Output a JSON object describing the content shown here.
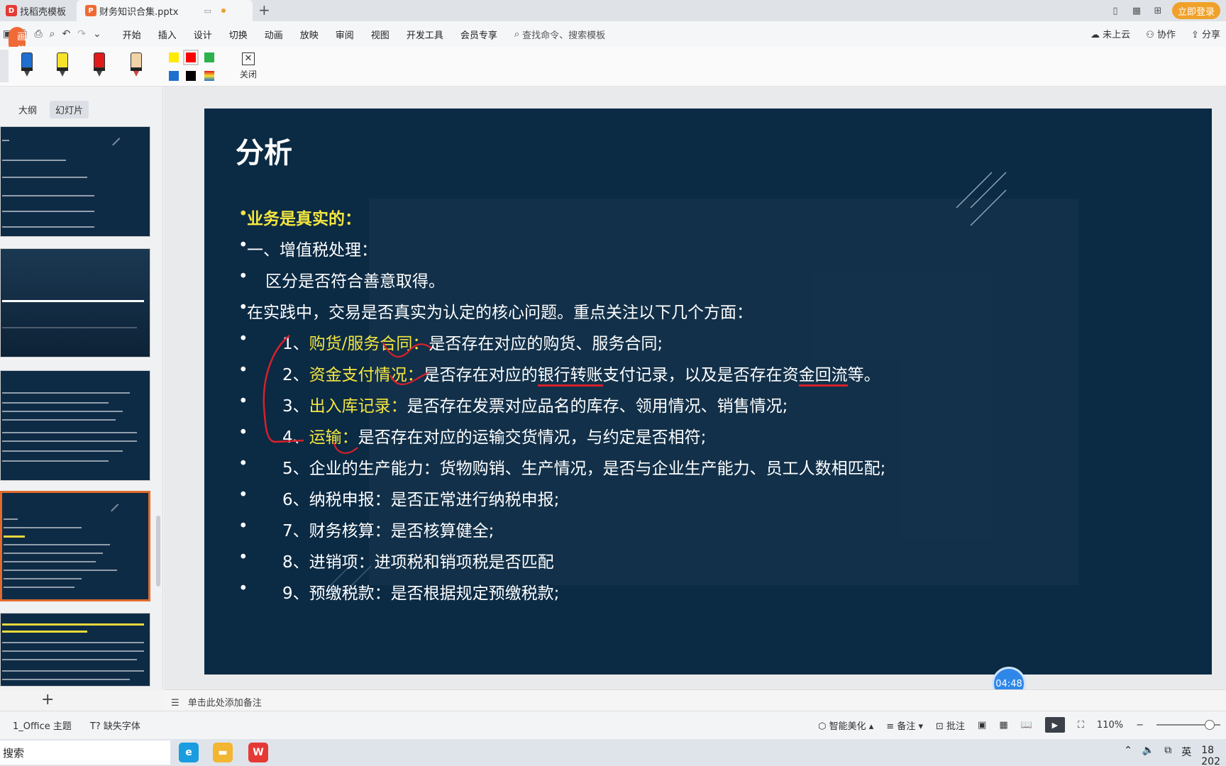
{
  "tabs": [
    {
      "label": "找稻壳模板",
      "logo": "D",
      "logo_color": "#e53935"
    },
    {
      "label": "财务知识合集.pptx",
      "logo": "P",
      "logo_color": "#f06a35"
    }
  ],
  "titlebar": {
    "login_label": "立即登录"
  },
  "menu": {
    "items": [
      "开始",
      "插入",
      "设计",
      "切换",
      "动画",
      "放映",
      "审阅",
      "视图",
      "开发工具",
      "会员专享"
    ],
    "pen_label": "画笔",
    "search_placeholder": "查找命令、搜索模板",
    "right": [
      "未上云",
      "协作",
      "分享"
    ]
  },
  "pen_toolbar": {
    "pens": [
      {
        "name": "blue-pen",
        "color": "#1f6fd1"
      },
      {
        "name": "yellow-highlighter",
        "color": "#f6e22a"
      },
      {
        "name": "red-pen",
        "color": "#e11b1b"
      },
      {
        "name": "beige-marker",
        "color": "#f1d3a8"
      }
    ],
    "swatches": [
      "#ffeb00",
      "#ff0000",
      "#2bb24c",
      "#1f6fd1",
      "#000000",
      "multi"
    ],
    "close_label": "关闭"
  },
  "left_panel": {
    "tabs": [
      "大纲",
      "幻灯片"
    ],
    "active_tab": "幻灯片"
  },
  "slide": {
    "title": "分析",
    "bullets": [
      {
        "text": "业务是真实的：",
        "style": "yellow-bold"
      },
      {
        "text": "一、增值税处理："
      },
      {
        "text": "区分是否符合善意取得。",
        "indent": 1
      },
      {
        "text": "在实践中，交易是否真实为认定的核心问题。重点关注以下几个方面："
      },
      {
        "num": "1、",
        "key": "购货/服务合同：",
        "rest": "是否存在对应的购货、服务合同;"
      },
      {
        "num": "2、",
        "key": "资金支付情况：",
        "rest_a": "是否存在对应的",
        "ul_a": "银行转账",
        "rest_b": "支付记录，以及是否存在资",
        "ul_b": "金回流",
        "rest_c": "等。"
      },
      {
        "num": "3、",
        "key": "出入库记录：",
        "rest": "是否存在发票对应品名的库存、领用情况、销售情况;"
      },
      {
        "num": "4、",
        "key": "运输：",
        "rest": "是否存在对应的运输交货情况，与约定是否相符;"
      },
      {
        "num": "5、",
        "rest": "企业的生产能力：货物购销、生产情况，是否与企业生产能力、员工人数相匹配;"
      },
      {
        "num": "6、",
        "rest": "纳税申报：是否正常进行纳税申报;"
      },
      {
        "num": "7、",
        "rest": "财务核算：是否核算健全;"
      },
      {
        "num": "8、",
        "rest": "进销项：进项税和销项税是否匹配"
      },
      {
        "num": "9、",
        "rest": "预缴税款：是否根据规定预缴税款;"
      }
    ]
  },
  "timer": "04:48",
  "notes_placeholder": "单击此处添加备注",
  "status": {
    "theme": "1_Office 主题",
    "missing_font": "缺失字体",
    "beautify": "智能美化",
    "notes": "备注",
    "comments": "批注",
    "zoom": "110%"
  },
  "taskbar": {
    "search": "搜索",
    "ime": "英",
    "time": "18",
    "date": "202"
  },
  "colors": {
    "slide_bg": "#0b2a44",
    "highlight": "#f4e640",
    "ink": "#d8202a",
    "accent": "#f06a35"
  }
}
